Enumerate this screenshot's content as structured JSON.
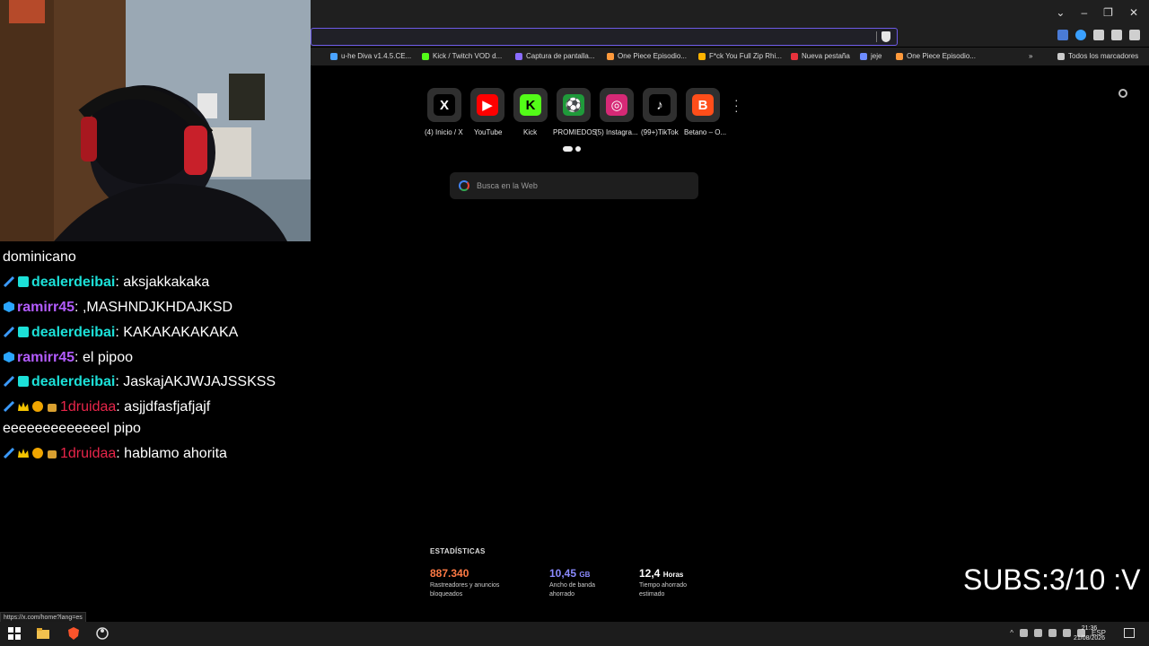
{
  "bookmarks": [
    {
      "label": "u-he Diva v1.4.5.CE...",
      "color": "#4aa3ff"
    },
    {
      "label": "Kick / Twitch VOD d...",
      "color": "#53fc18"
    },
    {
      "label": "Captura de pantalla...",
      "color": "#8a6cff"
    },
    {
      "label": "One Piece Episodio...",
      "color": "#ff9a3c"
    },
    {
      "label": "F*ck You Full Zip Rhi...",
      "color": "#ffb400"
    },
    {
      "label": "Nueva pestaña",
      "color": "#e8323c"
    },
    {
      "label": "jeje",
      "color": "#6d8cff"
    },
    {
      "label": "One Piece Episodio...",
      "color": "#ff9a3c"
    },
    {
      "label": "Todos los marcadores",
      "color": "#cccccc"
    }
  ],
  "shortcuts": [
    {
      "label": "(4) Inicio / X",
      "glyph": "X",
      "icon": "x-logo-icon",
      "bg": "#000000",
      "fg": "#ffffff"
    },
    {
      "label": "YouTube",
      "glyph": "▶",
      "icon": "youtube-icon",
      "bg": "#ff0000",
      "fg": "#ffffff"
    },
    {
      "label": "Kick",
      "glyph": "K",
      "icon": "kick-icon",
      "bg": "#53fc18",
      "fg": "#000000"
    },
    {
      "label": "PROMIEDOS",
      "glyph": "⚽",
      "icon": "promiedos-icon",
      "bg": "#1f9a3a",
      "fg": "#ffffff"
    },
    {
      "label": "(5) Instagra...",
      "glyph": "◎",
      "icon": "instagram-icon",
      "bg": "#d62976",
      "fg": "#ffffff"
    },
    {
      "label": "(99+)TikTok",
      "glyph": "♪",
      "icon": "tiktok-icon",
      "bg": "#000000",
      "fg": "#ffffff"
    },
    {
      "label": "Betano – O...",
      "glyph": "B",
      "icon": "betano-icon",
      "bg": "#ff4e1a",
      "fg": "#ffffff"
    }
  ],
  "search": {
    "placeholder": "Busca en la Web"
  },
  "stats": {
    "title": "ESTADÍSTICAS",
    "trackers_value": "887.340",
    "trackers_caption": "Rastreadores y anuncios bloqueados",
    "bandwidth_value": "10,45",
    "bandwidth_unit": "GB",
    "bandwidth_caption": "Ancho de banda ahorrado",
    "time_value": "12,4",
    "time_unit": "Horas",
    "time_caption": "Tiempo ahorrado estimado",
    "colors": {
      "trackers": "#ff7a45",
      "bandwidth": "#8b8bff",
      "time": "#ffffff"
    }
  },
  "status_url": "https://x.com/home?lang=es",
  "chat": {
    "lines": [
      {
        "user": "",
        "text": "dominicano"
      },
      {
        "user": "dealerdeibai",
        "text": "aksjakkakaka"
      },
      {
        "user": "ramirr45",
        "text": ",MASHNDJKHDAJKSD"
      },
      {
        "user": "dealerdeibai",
        "text": "KAKAKAKAKAKA"
      },
      {
        "user": "ramirr45",
        "text": "el pipoo"
      },
      {
        "user": "dealerdeibai",
        "text": "JaskajAKJWJAJSSKSS"
      },
      {
        "user": "1druidaa",
        "text": "asjjdfasfjafjajf"
      },
      {
        "user": "",
        "text": "eeeeeeeeeeeeel pipo"
      },
      {
        "user": "1druidaa",
        "text": "hablamo ahorita"
      }
    ]
  },
  "overlay": {
    "subs": "SUBS:3/10 :V"
  },
  "taskbar": {
    "language": "ESP",
    "time": "21:36",
    "date": "21/08/2026"
  }
}
